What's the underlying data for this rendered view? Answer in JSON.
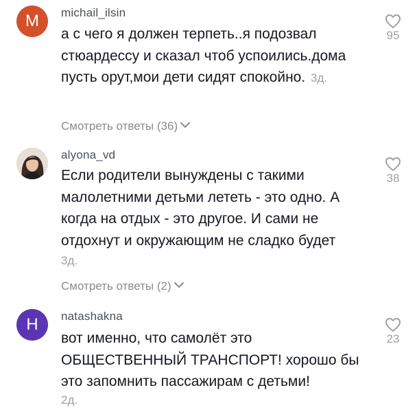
{
  "comments": [
    {
      "username": "michail_ilsin",
      "avatar_letter": "M",
      "avatar_color": "#d2512c",
      "text": "а с чего я должен терпеть..я подозвал стюардессу и сказал чтоб успоились.дома пусть орут,мои дети сидят спокойно.",
      "time": "3д.",
      "replies": "Смотреть ответы (36)",
      "likes": "95"
    },
    {
      "username": "alyona_vd",
      "avatar_letter": "",
      "avatar_color": "#d9cfc7",
      "text": "Если родители вынуждены с такими малолетними детьми лететь - это одно. А когда на отдых - это другое. И сами не отдохнут и окружающим не сладко будет",
      "time": "3д.",
      "replies": "Смотреть ответы (2)",
      "likes": "38"
    },
    {
      "username": "natashakna",
      "avatar_letter": "H",
      "avatar_color": "#5b35b3",
      "text": "вот именно, что самолёт это ОБЩЕСТВЕННЫЙ ТРАНСПОРТ! хорошо бы это запомнить пассажирам с детьми!",
      "time": "2д.",
      "likes": "23"
    }
  ]
}
